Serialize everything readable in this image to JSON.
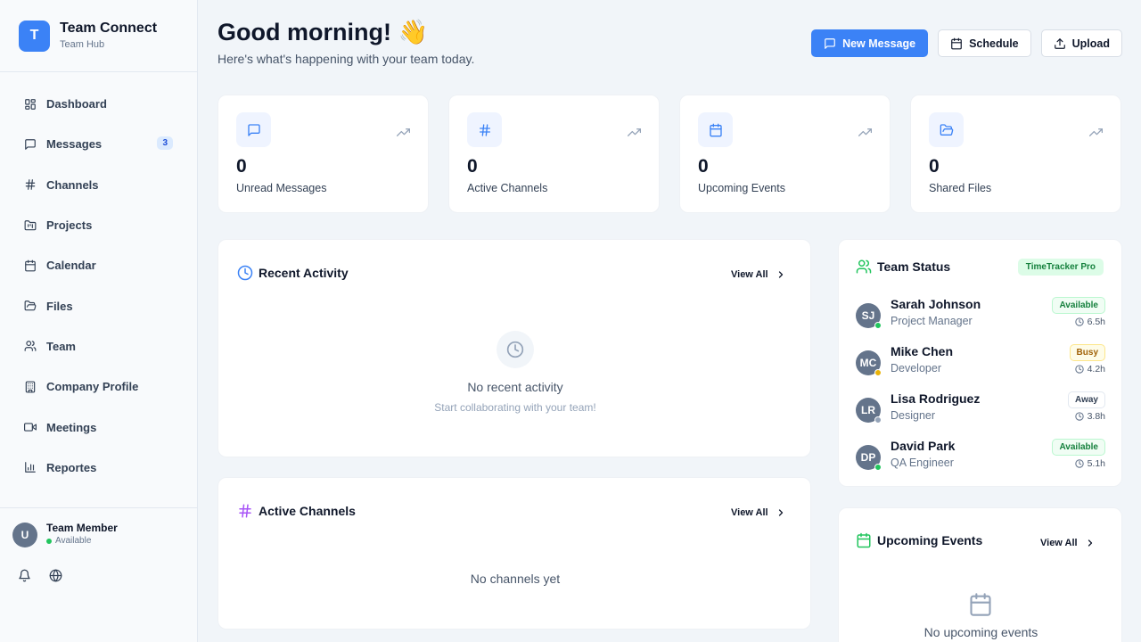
{
  "brand": {
    "logo_letter": "T",
    "title": "Team Connect",
    "subtitle": "Team Hub"
  },
  "sidebar": {
    "items": [
      {
        "label": "Dashboard",
        "icon": "dashboard-icon"
      },
      {
        "label": "Messages",
        "icon": "message-icon",
        "badge": "3"
      },
      {
        "label": "Channels",
        "icon": "hash-icon"
      },
      {
        "label": "Projects",
        "icon": "folder-kanban-icon"
      },
      {
        "label": "Calendar",
        "icon": "calendar-icon"
      },
      {
        "label": "Files",
        "icon": "folder-icon"
      },
      {
        "label": "Team",
        "icon": "users-icon"
      },
      {
        "label": "Company Profile",
        "icon": "building-icon"
      },
      {
        "label": "Meetings",
        "icon": "video-icon"
      },
      {
        "label": "Reportes",
        "icon": "bar-chart-icon"
      }
    ],
    "user": {
      "initial": "U",
      "name": "Team Member",
      "status": "Available"
    }
  },
  "header": {
    "greeting": "Good morning! 👋",
    "subtitle": "Here's what's happening with your team today.",
    "actions": {
      "new_message": "New Message",
      "schedule": "Schedule",
      "upload": "Upload"
    }
  },
  "stats": [
    {
      "value": "0",
      "label": "Unread Messages",
      "icon": "message-icon"
    },
    {
      "value": "0",
      "label": "Active Channels",
      "icon": "hash-icon"
    },
    {
      "value": "0",
      "label": "Upcoming Events",
      "icon": "calendar-icon"
    },
    {
      "value": "0",
      "label": "Shared Files",
      "icon": "folder-icon"
    }
  ],
  "recent_activity": {
    "title": "Recent Activity",
    "view_all": "View All",
    "empty_title": "No recent activity",
    "empty_subtitle": "Start collaborating with your team!"
  },
  "active_channels": {
    "title": "Active Channels",
    "view_all": "View All",
    "empty_title": "No channels yet"
  },
  "team_status": {
    "title": "Team Status",
    "badge": "TimeTracker Pro",
    "members": [
      {
        "initials": "SJ",
        "name": "Sarah Johnson",
        "role": "Project Manager",
        "status": "Available",
        "hours": "6.5h"
      },
      {
        "initials": "MC",
        "name": "Mike Chen",
        "role": "Developer",
        "status": "Busy",
        "hours": "4.2h"
      },
      {
        "initials": "LR",
        "name": "Lisa Rodriguez",
        "role": "Designer",
        "status": "Away",
        "hours": "3.8h"
      },
      {
        "initials": "DP",
        "name": "David Park",
        "role": "QA Engineer",
        "status": "Available",
        "hours": "5.1h"
      }
    ]
  },
  "upcoming_events": {
    "title": "Upcoming Events",
    "view_all": "View All",
    "empty_title": "No upcoming events"
  },
  "colors": {
    "primary": "#3b82f6",
    "available": "#22c55e",
    "busy": "#eab308",
    "away": "#94a3b8",
    "channels_accent": "#a855f7",
    "team_accent": "#22c55e"
  }
}
